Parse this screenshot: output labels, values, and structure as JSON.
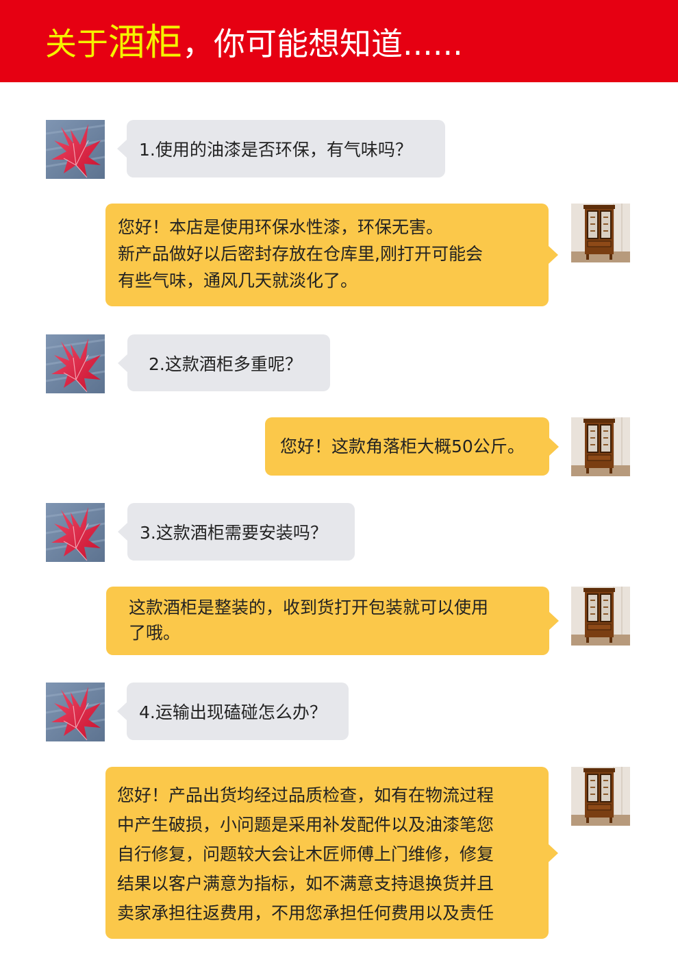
{
  "header": {
    "title_part1": "关于",
    "title_highlight": "酒柜",
    "title_part2": "，你可能想知道......"
  },
  "colors": {
    "header_bg": "#e60012",
    "highlight": "#f5f200",
    "question_bubble": "#e6e7eb",
    "answer_bubble": "#fbc84a"
  },
  "avatars": {
    "customer": "red-maple-leaf-avatar",
    "seller": "wooden-wine-cabinet-avatar"
  },
  "conversation": [
    {
      "question": "1.使用的油漆是否环保，有气味吗？",
      "answer": [
        "您好！本店是使用环保水性漆，环保无害。",
        "新产品做好以后密封存放在仓库里,刚打开可能会",
        "有些气味，通风几天就淡化了。"
      ]
    },
    {
      "question": "2.这款酒柜多重呢？",
      "answer": [
        "您好！这款角落柜大概50公斤。"
      ]
    },
    {
      "question": "3.这款酒柜需要安装吗？",
      "answer": [
        "这款酒柜是整装的，收到货打开包装就可以使用",
        "了哦。"
      ]
    },
    {
      "question": "4.运输出现磕碰怎么办？",
      "answer": [
        "您好！产品出货均经过品质检查，如有在物流过程",
        "中产生破损，小问题是采用补发配件以及油漆笔您",
        "自行修复，问题较大会让木匠师傅上门维修，修复",
        "结果以客户满意为指标，如不满意支持退换货并且",
        "卖家承担往返费用，不用您承担任何费用以及责任"
      ]
    }
  ]
}
